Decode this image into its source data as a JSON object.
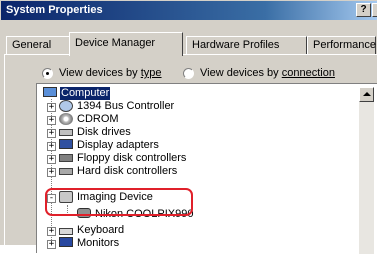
{
  "window": {
    "title": "System Properties",
    "help_label": "?",
    "close_label": "x"
  },
  "tabs": [
    {
      "label": "General",
      "active": false
    },
    {
      "label": "Device Manager",
      "active": true
    },
    {
      "label": "Hardware Profiles",
      "active": false
    },
    {
      "label": "Performance",
      "active": false
    }
  ],
  "view_options": {
    "by_type": {
      "prefix": "View devices by ",
      "underlined": "type",
      "selected": true
    },
    "by_connection": {
      "prefix": "View devices by ",
      "underlined": "connection",
      "selected": false
    }
  },
  "tree": {
    "root": {
      "label": "Computer",
      "selected": true,
      "icon": "computer-icon"
    },
    "items": [
      {
        "label": "1394 Bus Controller",
        "icon": "bus-icon",
        "expander": "+"
      },
      {
        "label": "CDROM",
        "icon": "cdrom-icon",
        "expander": "+"
      },
      {
        "label": "Disk drives",
        "icon": "disk-icon",
        "expander": "+"
      },
      {
        "label": "Display adapters",
        "icon": "display-icon",
        "expander": "+"
      },
      {
        "label": "Floppy disk controllers",
        "icon": "floppy-icon",
        "expander": "+"
      },
      {
        "label": "Hard disk controllers",
        "icon": "hdd-icon",
        "expander": "+"
      },
      {
        "label": "Imaging Device",
        "icon": "imaging-icon",
        "expander": "-"
      },
      {
        "label": "Nikon COOLPIX990",
        "icon": "camera-icon",
        "child": true
      },
      {
        "label": "Keyboard",
        "icon": "keyboard-icon",
        "expander": "+"
      },
      {
        "label": "Monitors",
        "icon": "monitor-icon",
        "expander": "+"
      }
    ]
  },
  "annotation": {
    "color": "#e0202a",
    "target": "Imaging Device"
  },
  "colors": {
    "title_bar": "#0a246a",
    "face": "#d4d0c8",
    "selection": "#0a246a"
  }
}
